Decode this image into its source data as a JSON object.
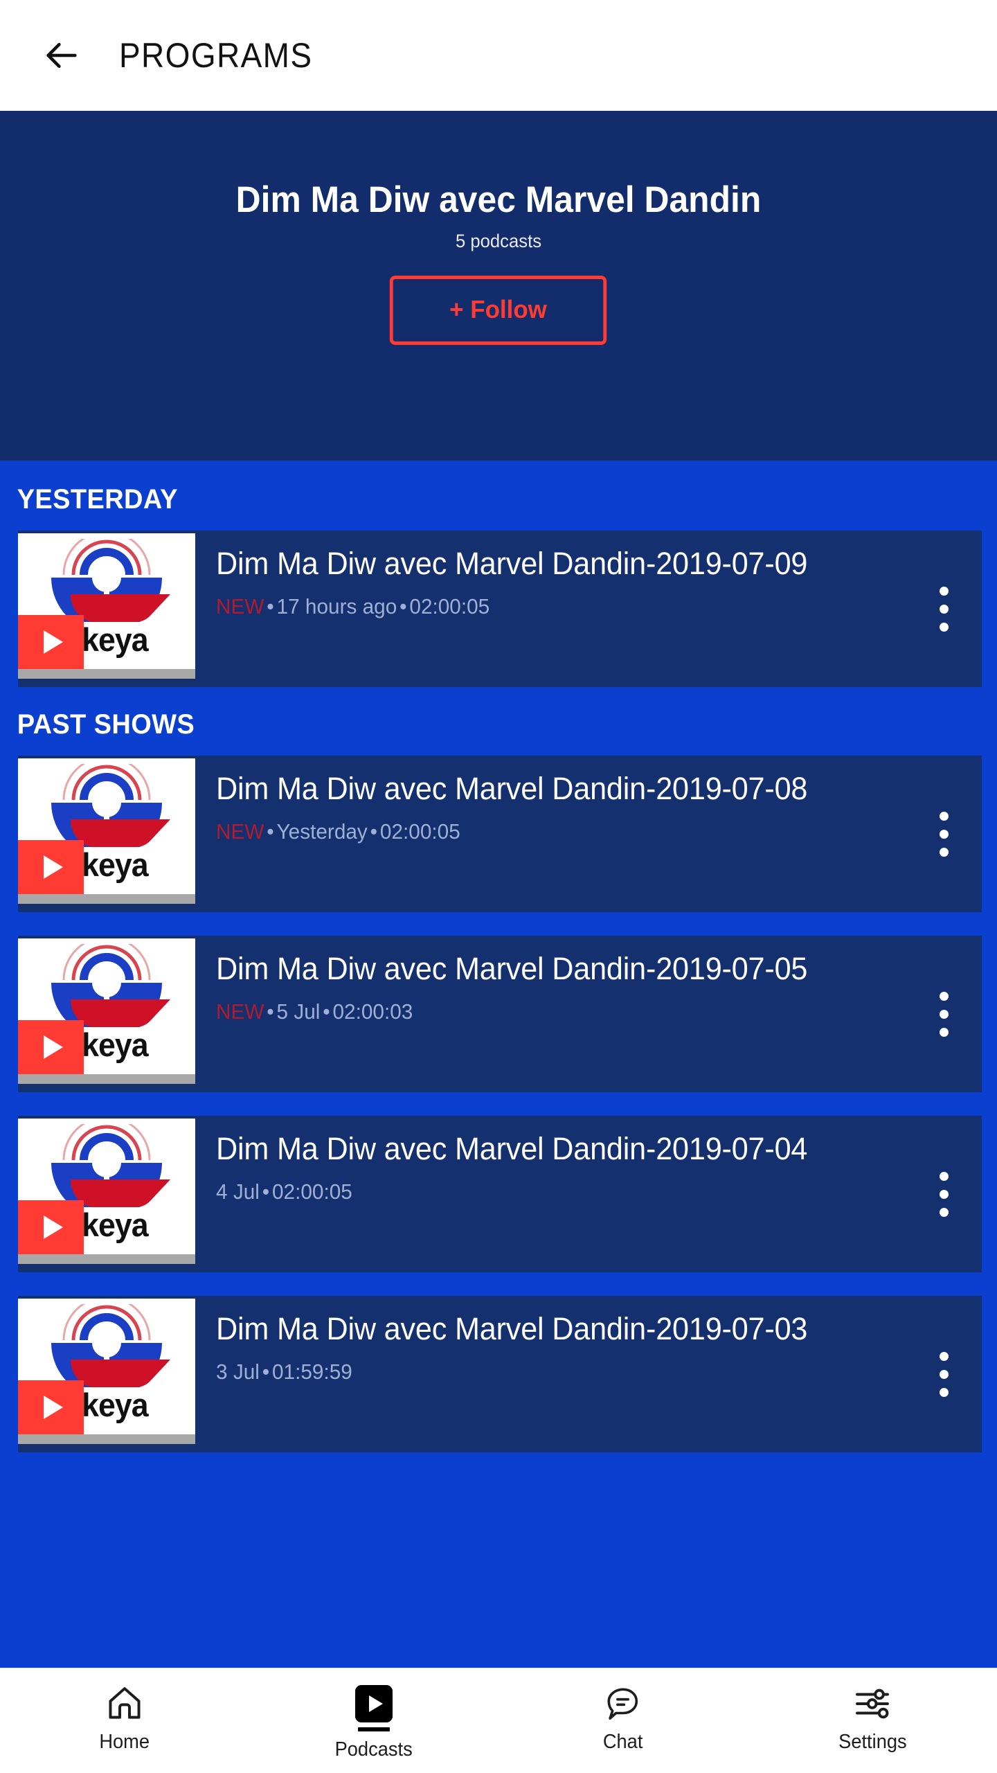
{
  "appbar": {
    "back_icon": "arrow-left-icon",
    "title": "PROGRAMS"
  },
  "hero": {
    "title": "Dim Ma Diw avec Marvel Dandin",
    "subtitle": "5 podcasts",
    "follow_label": "+ Follow",
    "accent_color": "#FF3B33",
    "background_color": "#132C6B"
  },
  "colors": {
    "page_background": "#0B3FD0",
    "card_background": "#14306E",
    "meta_text": "#9FB0D4",
    "new_badge": "#B01C2E",
    "progress_bar": "#A8A8A8"
  },
  "sections": [
    {
      "header": "YESTERDAY",
      "items": [
        {
          "title": "Dim Ma Diw avec Marvel Dandin-2019-07-09",
          "is_new": true,
          "new_label": "NEW",
          "date": "17 hours ago",
          "duration": "02:00:05",
          "thumbnail_label": "skeya"
        }
      ]
    },
    {
      "header": "PAST SHOWS",
      "items": [
        {
          "title": "Dim Ma Diw avec Marvel Dandin-2019-07-08",
          "is_new": true,
          "new_label": "NEW",
          "date": "Yesterday",
          "duration": "02:00:05",
          "thumbnail_label": "skeya"
        },
        {
          "title": "Dim Ma Diw avec Marvel Dandin-2019-07-05",
          "is_new": true,
          "new_label": "NEW",
          "date": "5 Jul",
          "duration": "02:00:03",
          "thumbnail_label": "skeya"
        },
        {
          "title": "Dim Ma Diw avec Marvel Dandin-2019-07-04",
          "is_new": false,
          "new_label": "",
          "date": "4 Jul",
          "duration": "02:00:05",
          "thumbnail_label": "skeya"
        },
        {
          "title": "Dim Ma Diw avec Marvel Dandin-2019-07-03",
          "is_new": false,
          "new_label": "",
          "date": "3 Jul",
          "duration": "01:59:59",
          "thumbnail_label": "skeya"
        }
      ]
    }
  ],
  "separator": "•",
  "bottom_nav": {
    "items": [
      {
        "label": "Home",
        "icon": "home-icon",
        "active": false
      },
      {
        "label": "Podcasts",
        "icon": "podcasts-icon",
        "active": true
      },
      {
        "label": "Chat",
        "icon": "chat-icon",
        "active": false
      },
      {
        "label": "Settings",
        "icon": "sliders-icon",
        "active": false
      }
    ]
  }
}
